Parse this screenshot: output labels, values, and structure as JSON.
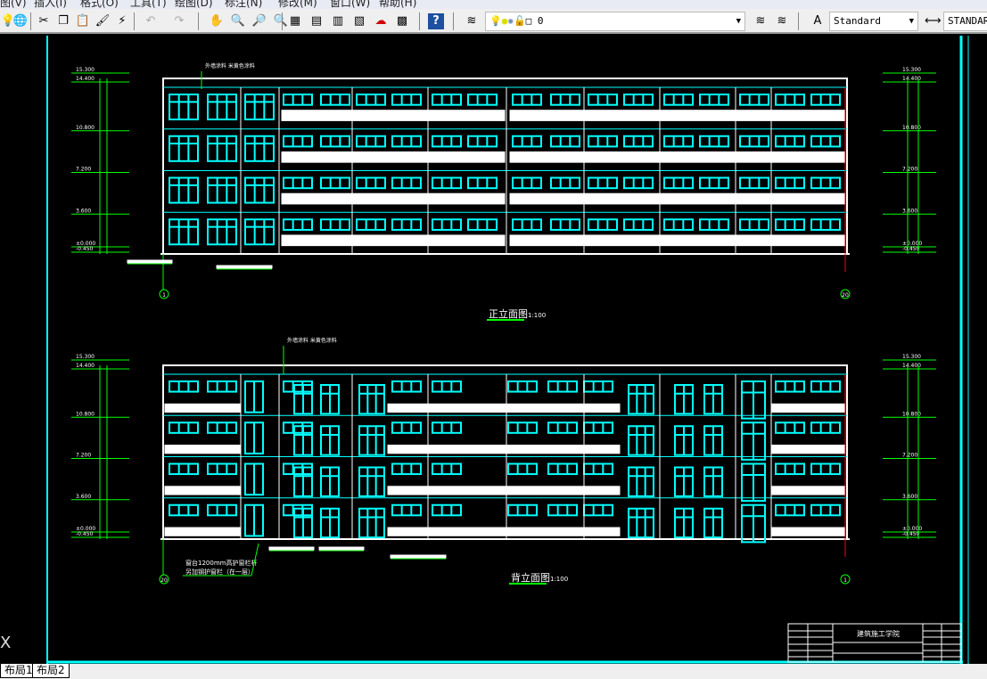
{
  "menu": [
    "图(V)",
    "插入(I)",
    "格式(O)",
    "工具(T)",
    "绘图(D)",
    "标注(N)",
    "修改(M)",
    "窗口(W)",
    "帮助(H)"
  ],
  "toolbar": {
    "layer": "0",
    "text_style": "Standard",
    "dim_style": "STANDARD"
  },
  "drawing": {
    "front": {
      "title": "正立面图",
      "scale": "1:100",
      "note": "外墙涂料 米黄色涂料"
    },
    "rear": {
      "title": "背立面图",
      "scale": "1:100",
      "note": "外墙涂料 米黄色涂料",
      "note2a": "窗台1200mm高护窗栏杆",
      "note2b": "另加钢护窗栏（在一层）"
    },
    "levels": [
      "15.300",
      "14.400",
      "10.800",
      "7.200",
      "3.600",
      "±0.000",
      "-0.450"
    ],
    "axis_left": "1",
    "axis_right": "20",
    "title_block": {
      "school": "建筑施工学院"
    }
  },
  "tabs": [
    "布局1",
    "布局2"
  ],
  "colors": {
    "cyan": "#00ffff",
    "green": "#00ff00",
    "white": "#ffffff",
    "red": "#ff0000"
  }
}
